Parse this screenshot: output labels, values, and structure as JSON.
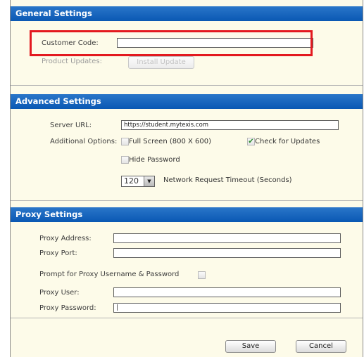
{
  "general": {
    "header": "General Settings",
    "customer_code_label": "Customer Code:",
    "customer_code_value": "",
    "product_updates_label": "Product Updates:",
    "install_update_label": "Install Update"
  },
  "advanced": {
    "header": "Advanced Settings",
    "server_url_label": "Server URL:",
    "server_url_value": "https://student.mytexis.com",
    "additional_options_label": "Additional Options:",
    "full_screen_label": "Full Screen (800 X 600)",
    "full_screen_checked": false,
    "check_updates_label": "Check for Updates",
    "check_updates_checked": true,
    "hide_password_label": "Hide Password",
    "hide_password_checked": false,
    "timeout_value": "120",
    "timeout_label": "Network Request Timeout (Seconds)"
  },
  "proxy": {
    "header": "Proxy Settings",
    "address_label": "Proxy Address:",
    "address_value": "",
    "port_label": "Proxy Port:",
    "port_value": "",
    "prompt_label": "Prompt for Proxy Username & Password",
    "prompt_checked": false,
    "user_label": "Proxy User:",
    "user_value": "",
    "password_label": "Proxy Password:",
    "password_value": "|"
  },
  "footer": {
    "save_label": "Save",
    "cancel_label": "Cancel"
  },
  "colors": {
    "header_blue": "#0a58b3",
    "panel_bg": "#fdfbe9",
    "highlight_red": "#e3191f",
    "check_green": "#2a8a2a"
  },
  "icons": {
    "checkmark": "checkmark-icon",
    "dropdown": "chevron-down-icon"
  }
}
